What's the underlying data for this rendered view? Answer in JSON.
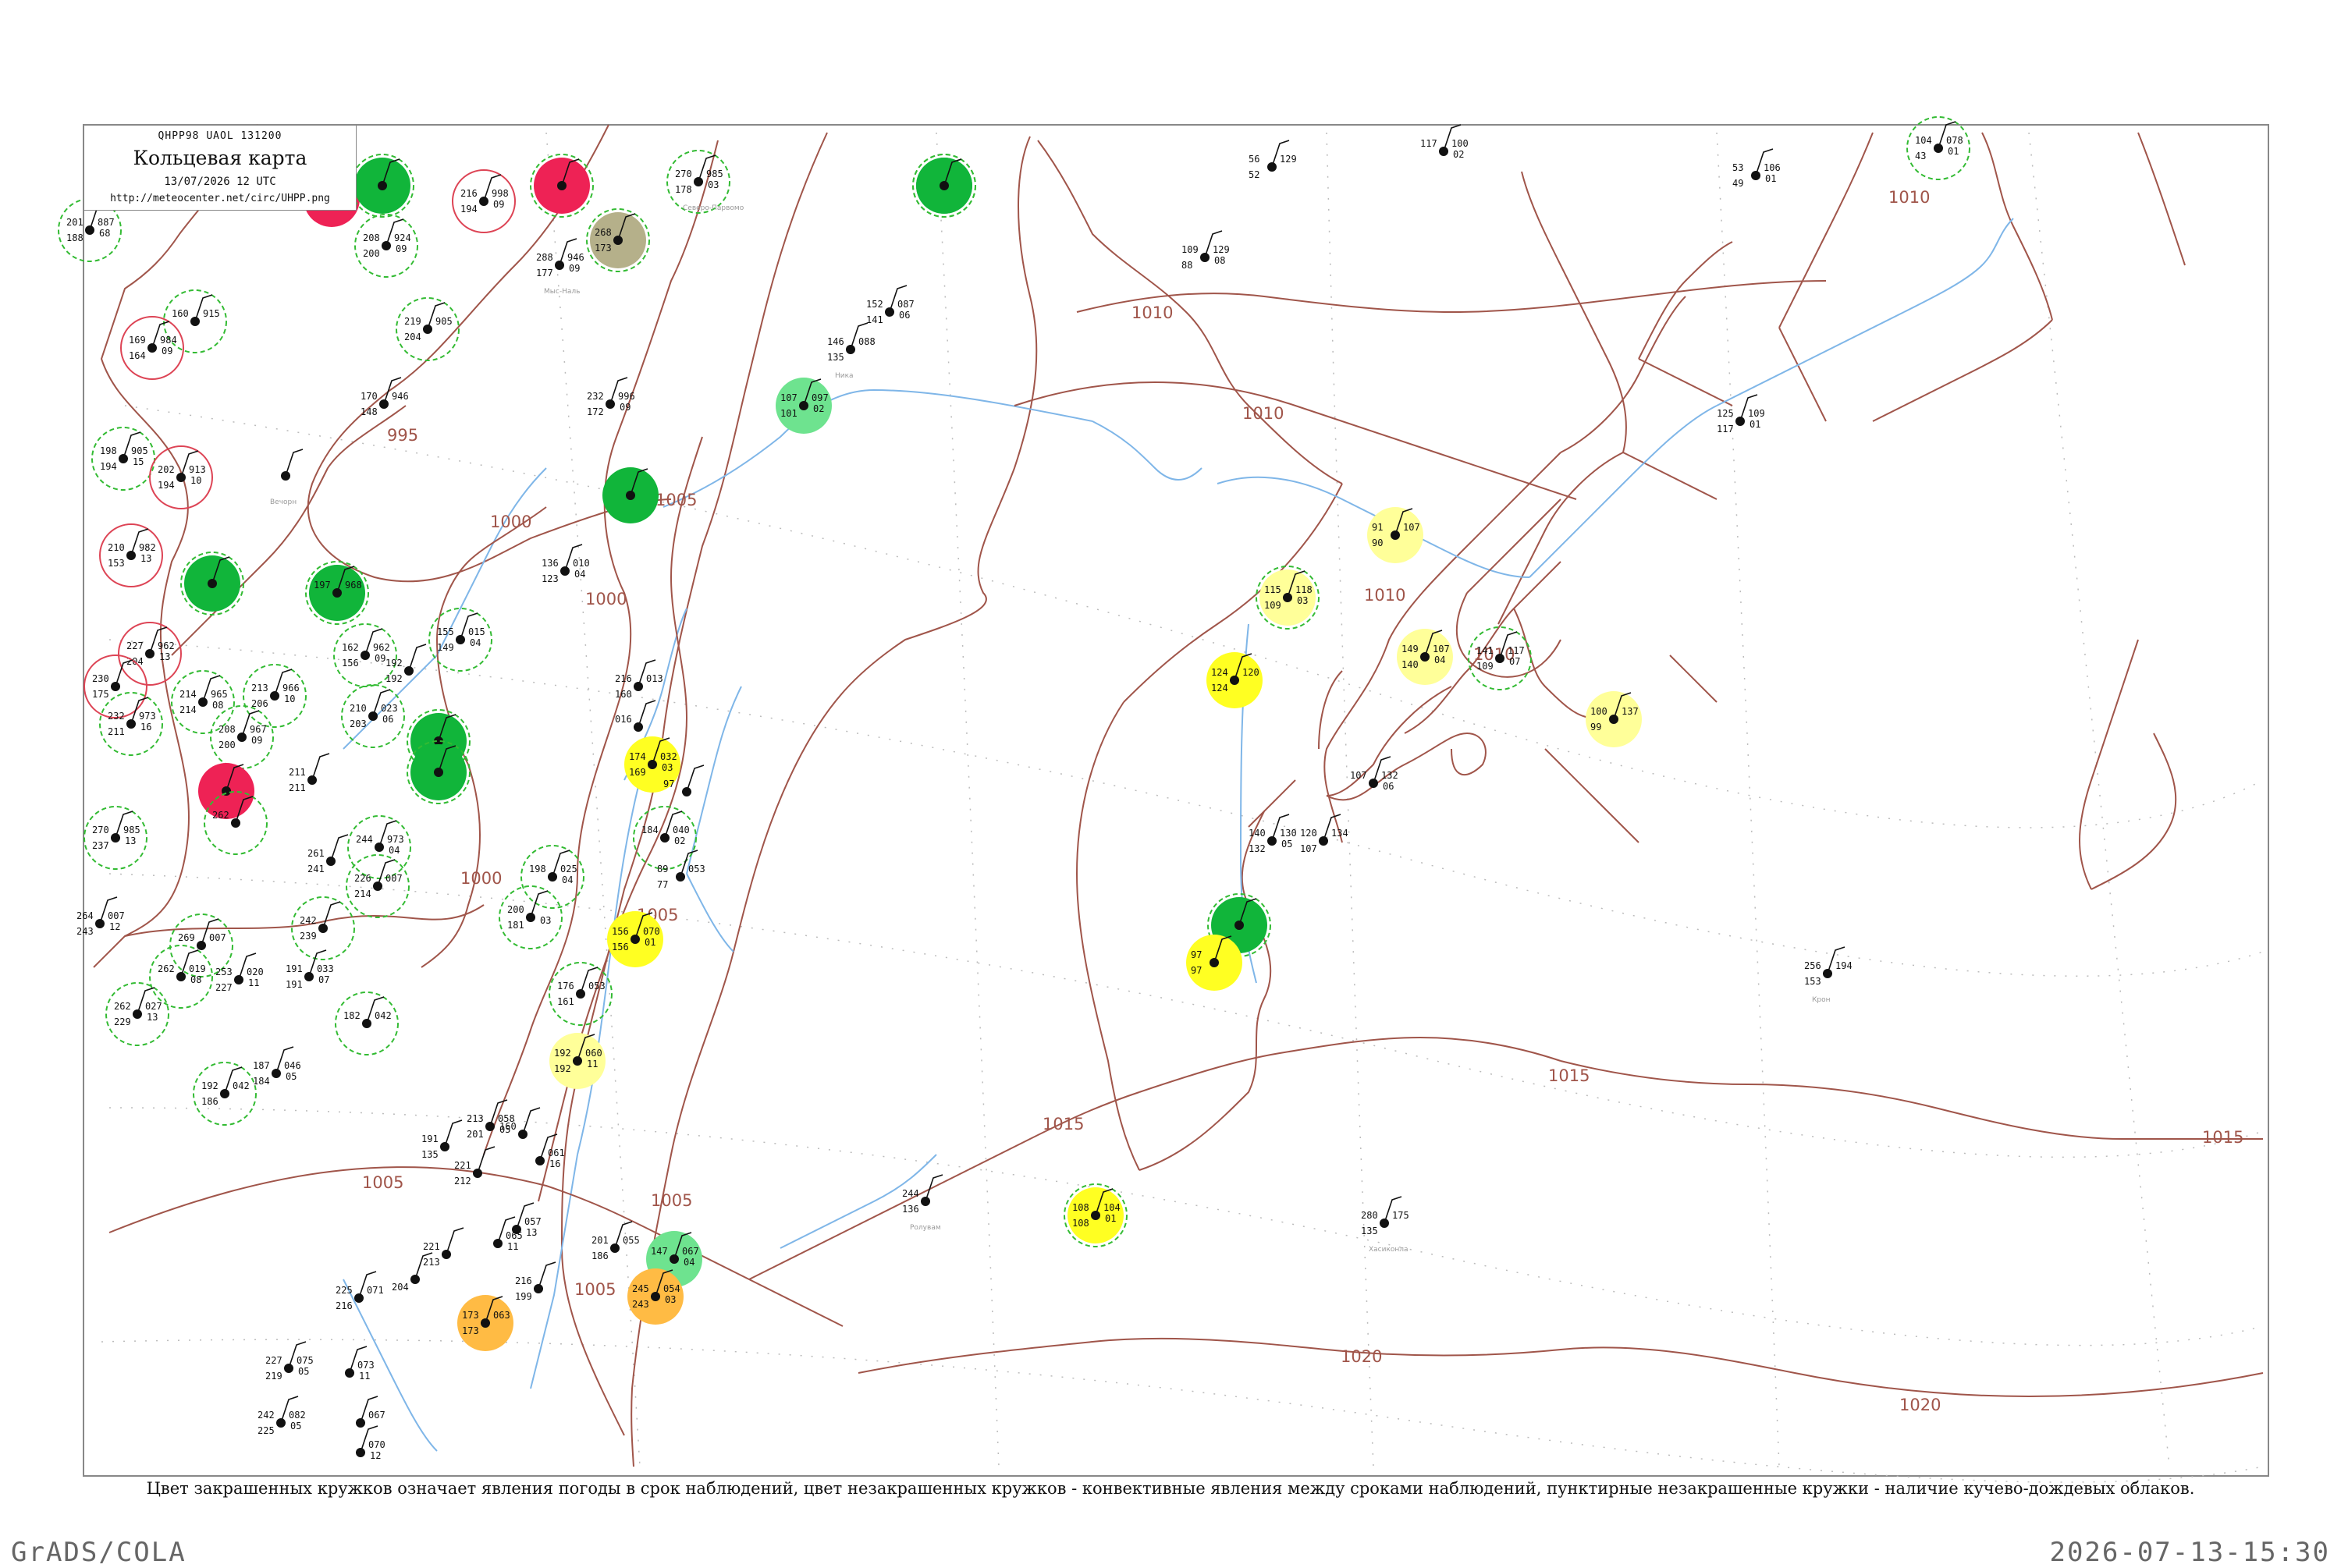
{
  "header": {
    "code": "QHPP98  UAOL  131200",
    "title": "Кольцевая карта",
    "datetime": "13/07/2026 12 UTC",
    "url": "http://meteocenter.net/circ/UHPP.png"
  },
  "caption": "Цвет закрашенных кружков означает явления погоды в срок наблюдений, цвет незакрашенных кружков - конвективные явления между сроками наблюдений, пунктирные незакрашенные кружки - наличие кучево-дождевых облаков.",
  "footer": {
    "left": "GrADS/COLA",
    "right": "2026-07-13-15:30"
  },
  "colors": {
    "isobar": "#a0554a",
    "coast": "#a0554a",
    "river": "#7fb6e8",
    "frame": "#888888",
    "thunder_green": "#11b53a",
    "rain_light_green": "#6ee38f",
    "drizzle_yellow": "#ffff22",
    "mist_pale_yellow": "#ffff99",
    "red": "#ee2255",
    "olive": "#b5b08a",
    "orange": "#ffbb44",
    "dash_circle": "#33bb33",
    "red_ring": "#dd4455"
  },
  "isobar_labels": [
    "995",
    "1000",
    "1000",
    "1000",
    "1005",
    "1005",
    "1005",
    "1005",
    "1005",
    "1010",
    "1010",
    "1010",
    "1010",
    "1010",
    "1015",
    "1015",
    "1015",
    "1020",
    "1020"
  ],
  "stations": [
    {
      "fill": "none",
      "ring": "dash",
      "t": "201",
      "v": "887",
      "dp": "188",
      "p": "68",
      "name": ""
    },
    {
      "fill": "red",
      "ring": "none",
      "t": "",
      "v": "",
      "dp": "",
      "p": "",
      "name": ""
    },
    {
      "fill": "thunder",
      "ring": "dash",
      "t": "",
      "v": "",
      "dp": "",
      "p": "",
      "name": ""
    },
    {
      "fill": "none",
      "ring": "dash",
      "t": "208",
      "v": "924",
      "dp": "200",
      "p": "09",
      "name": ""
    },
    {
      "fill": "none",
      "ring": "red",
      "t": "216",
      "v": "998",
      "dp": "194",
      "p": "09",
      "name": ""
    },
    {
      "fill": "red",
      "ring": "dash",
      "t": "",
      "v": "",
      "dp": "",
      "p": "",
      "name": ""
    },
    {
      "fill": "olive",
      "ring": "dash",
      "t": "268",
      "v": "",
      "dp": "173",
      "p": "",
      "name": ""
    },
    {
      "fill": "none",
      "ring": "dash",
      "t": "270",
      "v": "985",
      "dp": "178",
      "p": "03",
      "name": "Северо-Парвомо"
    },
    {
      "fill": "thunder",
      "ring": "dash",
      "t": "",
      "v": "",
      "dp": "",
      "p": "",
      "name": ""
    },
    {
      "fill": "thunder",
      "ring": "dash",
      "t": "",
      "v": "",
      "dp": "",
      "p": "",
      "name": ""
    },
    {
      "fill": "none",
      "ring": "dash",
      "t": "160",
      "v": "915",
      "dp": "",
      "p": "",
      "name": ""
    },
    {
      "fill": "none",
      "ring": "red",
      "t": "169",
      "v": "984",
      "dp": "164",
      "p": "09",
      "name": ""
    },
    {
      "fill": "none",
      "ring": "dash",
      "t": "219",
      "v": "905",
      "dp": "204",
      "p": "",
      "name": ""
    },
    {
      "fill": "none",
      "ring": "none",
      "t": "288",
      "v": "946",
      "dp": "177",
      "p": "09",
      "name": "Мыс-Наль"
    },
    {
      "fill": "none",
      "ring": "none",
      "t": "170",
      "v": "946",
      "dp": "148",
      "p": "",
      "name": ""
    },
    {
      "fill": "none",
      "ring": "none",
      "t": "232",
      "v": "996",
      "dp": "172",
      "p": "09",
      "name": ""
    },
    {
      "fill": "none",
      "ring": "dash",
      "t": "198",
      "v": "905",
      "dp": "194",
      "p": "15",
      "name": ""
    },
    {
      "fill": "none",
      "ring": "red",
      "t": "202",
      "v": "913",
      "dp": "194",
      "p": "10",
      "name": ""
    },
    {
      "fill": "none",
      "ring": "none",
      "t": "",
      "v": "",
      "dp": "",
      "p": "",
      "name": "Вечорн"
    },
    {
      "fill": "none",
      "ring": "none",
      "t": "146",
      "v": "088",
      "dp": "135",
      "p": "",
      "name": "Ника"
    },
    {
      "fill": "none",
      "ring": "none",
      "t": "152",
      "v": "087",
      "dp": "141",
      "p": "06",
      "name": ""
    },
    {
      "fill": "light_green",
      "ring": "none",
      "t": "107",
      "v": "097",
      "dp": "101",
      "p": "02",
      "name": ""
    },
    {
      "fill": "thunder",
      "ring": "none",
      "t": "",
      "v": "",
      "dp": "",
      "p": "",
      "name": ""
    },
    {
      "fill": "none",
      "ring": "none",
      "t": "136",
      "v": "010",
      "dp": "123",
      "p": "04",
      "name": ""
    },
    {
      "fill": "none",
      "ring": "red",
      "t": "210",
      "v": "982",
      "dp": "153",
      "p": "13",
      "name": ""
    },
    {
      "fill": "thunder",
      "ring": "dash",
      "t": "",
      "v": "",
      "dp": "",
      "p": "",
      "name": ""
    },
    {
      "fill": "thunder",
      "ring": "dash",
      "t": "197",
      "v": "968",
      "dp": "",
      "p": "",
      "name": ""
    },
    {
      "fill": "none",
      "ring": "red",
      "t": "227",
      "v": "962",
      "dp": "204",
      "p": "13",
      "name": ""
    },
    {
      "fill": "none",
      "ring": "dash",
      "t": "162",
      "v": "962",
      "dp": "156",
      "p": "09",
      "name": ""
    },
    {
      "fill": "none",
      "ring": "dash",
      "t": "155",
      "v": "015",
      "dp": "149",
      "p": "04",
      "name": ""
    },
    {
      "fill": "none",
      "ring": "none",
      "t": "192",
      "v": "",
      "dp": "192",
      "p": "",
      "name": ""
    },
    {
      "fill": "none",
      "ring": "red",
      "t": "230",
      "v": "",
      "dp": "175",
      "p": "",
      "name": ""
    },
    {
      "fill": "none",
      "ring": "dash",
      "t": "214",
      "v": "965",
      "dp": "214",
      "p": "08",
      "name": ""
    },
    {
      "fill": "none",
      "ring": "dash",
      "t": "213",
      "v": "966",
      "dp": "206",
      "p": "10",
      "name": ""
    },
    {
      "fill": "none",
      "ring": "dash",
      "t": "210",
      "v": "023",
      "dp": "203",
      "p": "06",
      "name": ""
    },
    {
      "fill": "thunder",
      "ring": "dash",
      "t": "",
      "v": "",
      "dp": "",
      "p": "",
      "name": ""
    },
    {
      "fill": "none",
      "ring": "dash",
      "t": "232",
      "v": "973",
      "dp": "211",
      "p": "16",
      "name": ""
    },
    {
      "fill": "none",
      "ring": "dash",
      "t": "208",
      "v": "967",
      "dp": "200",
      "p": "09",
      "name": ""
    },
    {
      "fill": "thunder",
      "ring": "dash",
      "t": "",
      "v": "",
      "dp": "",
      "p": "",
      "name": ""
    },
    {
      "fill": "red",
      "ring": "none",
      "t": "",
      "v": "",
      "dp": "",
      "p": "",
      "name": ""
    },
    {
      "fill": "none",
      "ring": "none",
      "t": "216",
      "v": "013",
      "dp": "160",
      "p": "",
      "name": ""
    },
    {
      "fill": "none",
      "ring": "none",
      "t": "016",
      "v": "",
      "dp": "",
      "p": "",
      "name": ""
    },
    {
      "fill": "drizzle",
      "ring": "none",
      "t": "174",
      "v": "032",
      "dp": "169",
      "p": "03",
      "name": ""
    },
    {
      "fill": "none",
      "ring": "none",
      "t": "97",
      "v": "",
      "dp": "",
      "p": "",
      "name": ""
    },
    {
      "fill": "none",
      "ring": "none",
      "t": "211",
      "v": "",
      "dp": "211",
      "p": "",
      "name": ""
    },
    {
      "fill": "none",
      "ring": "dash",
      "t": "262",
      "v": "",
      "dp": "",
      "p": "",
      "name": ""
    },
    {
      "fill": "none",
      "ring": "dash",
      "t": "244",
      "v": "973",
      "dp": "",
      "p": "04",
      "name": ""
    },
    {
      "fill": "none",
      "ring": "dash",
      "t": "270",
      "v": "985",
      "dp": "237",
      "p": "13",
      "name": ""
    },
    {
      "fill": "none",
      "ring": "none",
      "t": "261",
      "v": "",
      "dp": "241",
      "p": "",
      "name": ""
    },
    {
      "fill": "none",
      "ring": "dash",
      "t": "184",
      "v": "040",
      "dp": "",
      "p": "02",
      "name": ""
    },
    {
      "fill": "none",
      "ring": "dash",
      "t": "226",
      "v": "007",
      "dp": "214",
      "p": "",
      "name": ""
    },
    {
      "fill": "none",
      "ring": "dash",
      "t": "198",
      "v": "025",
      "dp": "",
      "p": "04",
      "name": ""
    },
    {
      "fill": "none",
      "ring": "none",
      "t": "89",
      "v": "053",
      "dp": "77",
      "p": "",
      "name": ""
    },
    {
      "fill": "none",
      "ring": "none",
      "t": "264",
      "v": "007",
      "dp": "243",
      "p": "12",
      "name": ""
    },
    {
      "fill": "none",
      "ring": "dash",
      "t": "242",
      "v": "",
      "dp": "239",
      "p": "",
      "name": ""
    },
    {
      "fill": "none",
      "ring": "dash",
      "t": "269",
      "v": "007",
      "dp": "",
      "p": "",
      "name": ""
    },
    {
      "fill": "none",
      "ring": "dash",
      "t": "200",
      "v": "",
      "dp": "181",
      "p": "03",
      "name": ""
    },
    {
      "fill": "drizzle",
      "ring": "none",
      "t": "156",
      "v": "070",
      "dp": "156",
      "p": "01",
      "name": ""
    },
    {
      "fill": "none",
      "ring": "none",
      "t": "191",
      "v": "033",
      "dp": "191",
      "p": "07",
      "name": ""
    },
    {
      "fill": "none",
      "ring": "dash",
      "t": "262",
      "v": "019",
      "dp": "",
      "p": "08",
      "name": ""
    },
    {
      "fill": "none",
      "ring": "none",
      "t": "253",
      "v": "020",
      "dp": "227",
      "p": "11",
      "name": ""
    },
    {
      "fill": "none",
      "ring": "dash",
      "t": "176",
      "v": "053",
      "dp": "161",
      "p": "",
      "name": ""
    },
    {
      "fill": "none",
      "ring": "dash",
      "t": "262",
      "v": "027",
      "dp": "229",
      "p": "13",
      "name": ""
    },
    {
      "fill": "none",
      "ring": "dash",
      "t": "182",
      "v": "042",
      "dp": "",
      "p": "",
      "name": ""
    },
    {
      "fill": "mist",
      "ring": "none",
      "t": "192",
      "v": "060",
      "dp": "192",
      "p": "11",
      "name": ""
    },
    {
      "fill": "none",
      "ring": "none",
      "t": "187",
      "v": "046",
      "dp": "184",
      "p": "05",
      "name": ""
    },
    {
      "fill": "none",
      "ring": "dash",
      "t": "192",
      "v": "042",
      "dp": "186",
      "p": "",
      "name": ""
    },
    {
      "fill": "drizzle",
      "ring": "dash",
      "t": "108",
      "v": "104",
      "dp": "108",
      "p": "01",
      "name": ""
    },
    {
      "fill": "none",
      "ring": "none",
      "t": "109",
      "v": "129",
      "dp": "88",
      "p": "08",
      "name": ""
    },
    {
      "fill": "none",
      "ring": "none",
      "t": "56",
      "v": "129",
      "dp": "52",
      "p": "",
      "name": ""
    },
    {
      "fill": "none",
      "ring": "none",
      "t": "117",
      "v": "100",
      "dp": "",
      "p": "02",
      "name": ""
    },
    {
      "fill": "none",
      "ring": "none",
      "t": "53",
      "v": "106",
      "dp": "49",
      "p": "01",
      "name": ""
    },
    {
      "fill": "none",
      "ring": "dash",
      "t": "104",
      "v": "078",
      "dp": "43",
      "p": "01",
      "name": ""
    },
    {
      "fill": "none",
      "ring": "none",
      "t": "125",
      "v": "109",
      "dp": "117",
      "p": "01",
      "name": ""
    },
    {
      "fill": "mist",
      "ring": "none",
      "t": "91",
      "v": "107",
      "dp": "90",
      "p": "",
      "name": ""
    },
    {
      "fill": "mist",
      "ring": "dash",
      "t": "115",
      "v": "118",
      "dp": "109",
      "p": "03",
      "name": ""
    },
    {
      "fill": "drizzle",
      "ring": "none",
      "t": "124",
      "v": "120",
      "dp": "124",
      "p": "",
      "name": ""
    },
    {
      "fill": "mist",
      "ring": "none",
      "t": "149",
      "v": "107",
      "dp": "140",
      "p": "04",
      "name": ""
    },
    {
      "fill": "none",
      "ring": "dash",
      "t": "141",
      "v": "117",
      "dp": "109",
      "p": "07",
      "name": ""
    },
    {
      "fill": "mist",
      "ring": "none",
      "t": "100",
      "v": "137",
      "dp": "99",
      "p": "",
      "name": ""
    },
    {
      "fill": "none",
      "ring": "none",
      "t": "107",
      "v": "132",
      "dp": "",
      "p": "06",
      "name": ""
    },
    {
      "fill": "none",
      "ring": "none",
      "t": "140",
      "v": "130",
      "dp": "132",
      "p": "05",
      "name": ""
    },
    {
      "fill": "none",
      "ring": "none",
      "t": "120",
      "v": "134",
      "dp": "107",
      "p": "",
      "name": ""
    },
    {
      "fill": "thunder",
      "ring": "dash",
      "t": "",
      "v": "",
      "dp": "",
      "p": "",
      "name": ""
    },
    {
      "fill": "drizzle",
      "ring": "none",
      "t": "97",
      "v": "",
      "dp": "97",
      "p": "",
      "name": ""
    },
    {
      "fill": "none",
      "ring": "none",
      "t": "256",
      "v": "194",
      "dp": "153",
      "p": "",
      "name": "Крон"
    },
    {
      "fill": "none",
      "ring": "none",
      "t": "244",
      "v": "",
      "dp": "136",
      "p": "",
      "name": "Ролувам"
    },
    {
      "fill": "none",
      "ring": "none",
      "t": "280",
      "v": "175",
      "dp": "135",
      "p": "",
      "name": "Хасиконла"
    },
    {
      "fill": "none",
      "ring": "none",
      "t": "191",
      "v": "",
      "dp": "135",
      "p": "",
      "name": ""
    },
    {
      "fill": "none",
      "ring": "none",
      "t": "213",
      "v": "058",
      "dp": "201",
      "p": "05",
      "name": ""
    },
    {
      "fill": "none",
      "ring": "none",
      "t": "160",
      "v": "",
      "dp": "",
      "p": "",
      "name": ""
    },
    {
      "fill": "none",
      "ring": "none",
      "t": "",
      "v": "061",
      "dp": "",
      "p": "16",
      "name": ""
    },
    {
      "fill": "none",
      "ring": "none",
      "t": "221",
      "v": "",
      "dp": "212",
      "p": "",
      "name": ""
    },
    {
      "fill": "none",
      "ring": "none",
      "t": "",
      "v": "057",
      "dp": "",
      "p": "13",
      "name": ""
    },
    {
      "fill": "none",
      "ring": "none",
      "t": "221",
      "v": "",
      "dp": "213",
      "p": "",
      "name": ""
    },
    {
      "fill": "none",
      "ring": "none",
      "t": "",
      "v": "065",
      "dp": "",
      "p": "11",
      "name": ""
    },
    {
      "fill": "none",
      "ring": "none",
      "t": "201",
      "v": "055",
      "dp": "186",
      "p": "",
      "name": ""
    },
    {
      "fill": "light_green",
      "ring": "none",
      "t": "147",
      "v": "067",
      "dp": "",
      "p": "04",
      "name": ""
    },
    {
      "fill": "orange",
      "ring": "none",
      "t": "245",
      "v": "054",
      "dp": "243",
      "p": "03",
      "name": ""
    },
    {
      "fill": "orange",
      "ring": "none",
      "t": "173",
      "v": "063",
      "dp": "173",
      "p": "",
      "name": ""
    },
    {
      "fill": "none",
      "ring": "none",
      "t": "216",
      "v": "",
      "dp": "199",
      "p": "",
      "name": ""
    },
    {
      "fill": "none",
      "ring": "none",
      "t": "225",
      "v": "071",
      "dp": "216",
      "p": "",
      "name": ""
    },
    {
      "fill": "none",
      "ring": "none",
      "t": "",
      "v": "",
      "dp": "204",
      "p": "",
      "name": ""
    },
    {
      "fill": "none",
      "ring": "none",
      "t": "227",
      "v": "075",
      "dp": "219",
      "p": "05",
      "name": ""
    },
    {
      "fill": "none",
      "ring": "none",
      "t": "",
      "v": "073",
      "dp": "",
      "p": "11",
      "name": ""
    },
    {
      "fill": "none",
      "ring": "none",
      "t": "242",
      "v": "082",
      "dp": "225",
      "p": "05",
      "name": ""
    },
    {
      "fill": "none",
      "ring": "none",
      "t": "",
      "v": "067",
      "dp": "",
      "p": "",
      "name": ""
    },
    {
      "fill": "none",
      "ring": "none",
      "t": "",
      "v": "070",
      "dp": "",
      "p": "12",
      "name": ""
    }
  ]
}
